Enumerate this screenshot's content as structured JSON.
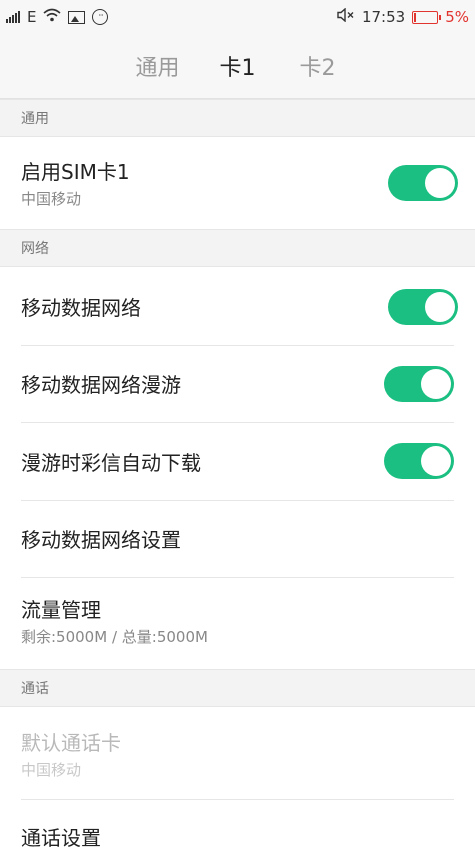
{
  "status_bar": {
    "network": "E",
    "time": "17:53",
    "battery_text": "5%",
    "battery_color": "#e2342f",
    "icons": [
      "signal-icon",
      "wifi-icon",
      "image-icon",
      "chat-icon",
      "mute-icon",
      "battery-icon"
    ]
  },
  "tabs": [
    {
      "label": "通用",
      "active": false
    },
    {
      "label": "卡1",
      "active": true
    },
    {
      "label": "卡2",
      "active": false
    }
  ],
  "sections": {
    "general": {
      "label": "通用"
    },
    "network": {
      "label": "网络"
    },
    "call": {
      "label": "通话"
    }
  },
  "items": {
    "enable_sim": {
      "title": "启用SIM卡1",
      "subtitle": "中国移动",
      "enabled": true
    },
    "mobile_data": {
      "title": "移动数据网络",
      "enabled": true
    },
    "data_roaming": {
      "title": "移动数据网络漫游",
      "enabled": true
    },
    "mms_roaming_download": {
      "title": "漫游时彩信自动下载",
      "enabled": true
    },
    "mobile_data_settings": {
      "title": "移动数据网络设置"
    },
    "traffic_management": {
      "title": "流量管理",
      "subtitle": "剩余:5000M / 总量:5000M"
    },
    "default_call_card": {
      "title": "默认通话卡",
      "subtitle": "中国移动",
      "disabled": true
    },
    "call_settings": {
      "title": "通话设置"
    }
  },
  "colors": {
    "accent": "#1bbf82"
  }
}
